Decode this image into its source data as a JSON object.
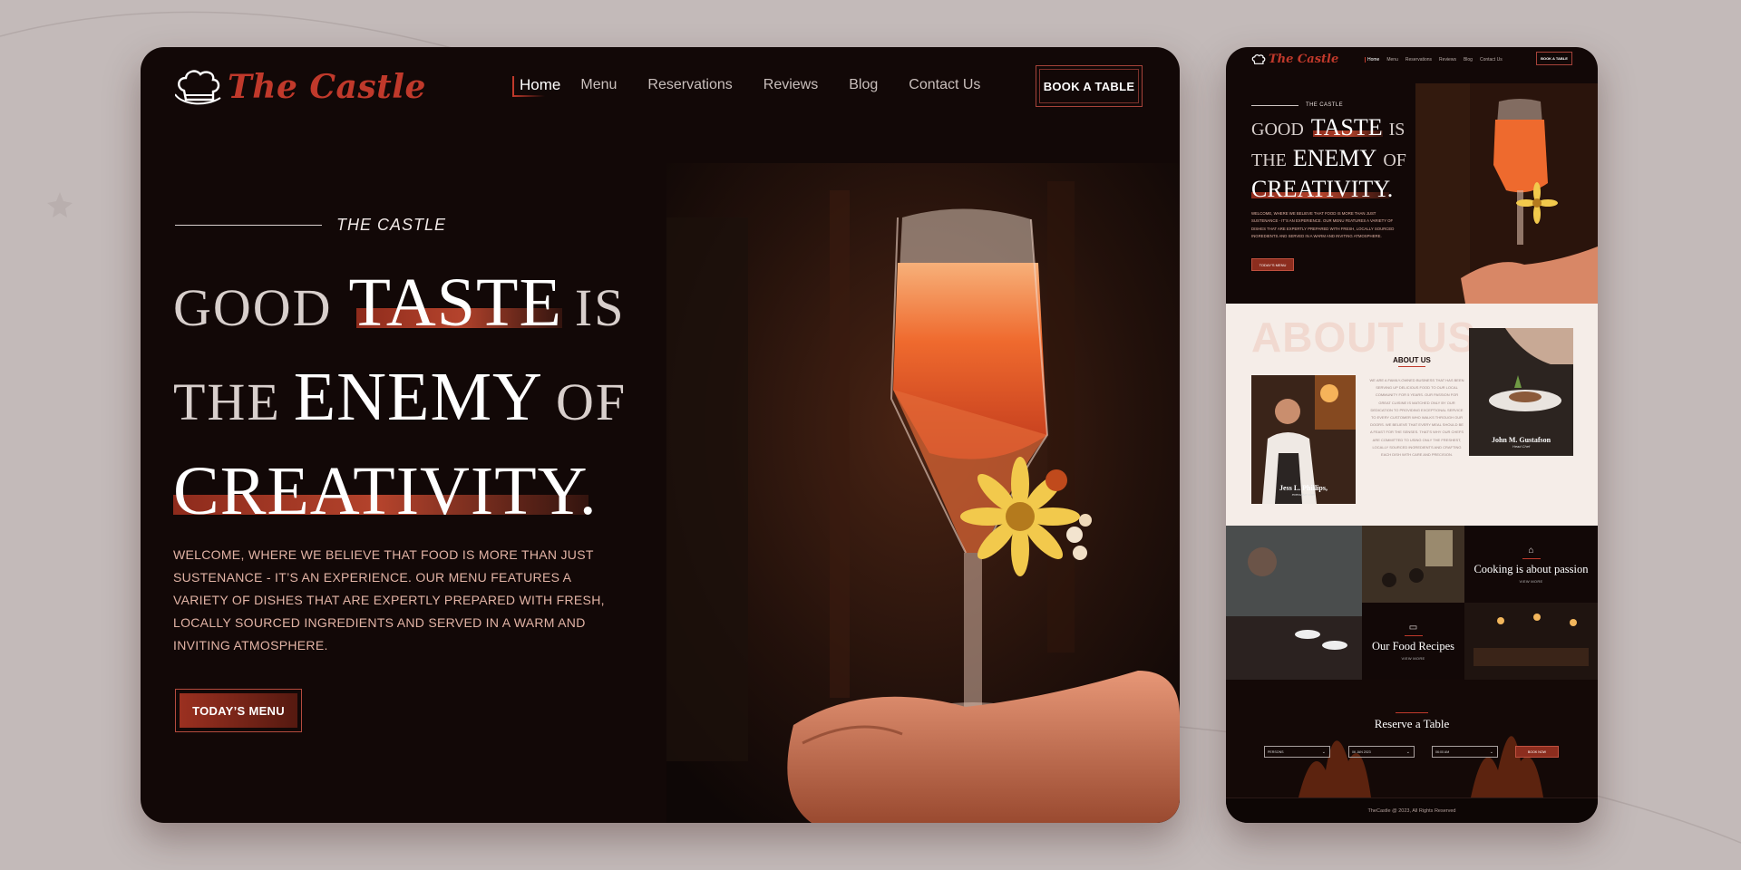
{
  "brand": {
    "name": "The Castle",
    "accent": "#c0392b"
  },
  "nav": {
    "items": [
      {
        "label": "Home",
        "active": true
      },
      {
        "label": "Menu"
      },
      {
        "label": "Reservations"
      },
      {
        "label": "Reviews"
      },
      {
        "label": "Blog"
      },
      {
        "label": "Contact Us"
      }
    ],
    "book_label": "BOOK A TABLE"
  },
  "hero": {
    "eyebrow": "THE CASTLE",
    "w1": "GOOD",
    "w2": "TASTE",
    "w3": "IS",
    "w4": "THE",
    "w5": "ENEMY",
    "w6": "OF",
    "w7": "CREATIVITY.",
    "description": "WELCOME, WHERE WE BELIEVE THAT FOOD IS MORE THAN JUST SUSTENANCE - IT’S AN EXPERIENCE. OUR MENU FEATURES A VARIETY OF DISHES THAT ARE EXPERTLY PREPARED WITH FRESH, LOCALLY SOURCED INGREDIENTS AND SERVED IN A WARM AND INVITING ATMOSPHERE.",
    "cta": "TODAY’S MENU"
  },
  "mobile": {
    "hero_desc": "WELCOME, WHERE WE BELIEVE THAT FOOD IS MORE THAN JUST SUSTENANCE - IT’S AN EXPERIENCE. OUR MENU FEATURES A VARIETY OF DISHES THAT ARE EXPERTLY PREPARED WITH FRESH, LOCALLY SOURCED INGREDIENTS AND SERVED IN A WARM AND INVITING ATMOSPHERE.",
    "about": {
      "watermark": "ABOUT US",
      "title": "ABOUT US",
      "text": "WE ARE A FAMILY-OWNED BUSINESS THAT HAS BEEN SERVING UP DELICIOUS FOOD TO OUR LOCAL COMMUNITY FOR 5 YEARS. OUR PASSION FOR GREAT CUISINE IS MATCHED ONLY BY OUR DEDICATION TO PROVIDING EXCEPTIONAL SERVICE TO EVERY CUSTOMER WHO WALKS THROUGH OUR DOORS. WE BELIEVE THAT EVERY MEAL SHOULD BE A FEAST FOR THE SENSES. THAT'S WHY OUR CHEFS ARE COMMITTED TO USING ONLY THE FRESHEST, LOCALLY SOURCED INGREDIENTS AND CRAFTING EACH DISH WITH CARE AND PRECISION.",
      "chef1_name": "Jess L. Phillips,",
      "chef1_role": "executive chef",
      "chef2_name": "John M. Gustafson",
      "chef2_role": "Head Chef"
    },
    "tiles": {
      "passion_title": "Cooking is about passion",
      "recipes_title": "Our Food Recipes",
      "view_more": "VIEW MORE"
    },
    "reserve": {
      "title": "Reserve a Table",
      "persons": "PERSONS",
      "date": "06 JAN 2023",
      "time": "06:00 AM",
      "book_now": "BOOK NOW"
    },
    "footer": "TheCastle @ 2023, All Rights Reserved"
  }
}
